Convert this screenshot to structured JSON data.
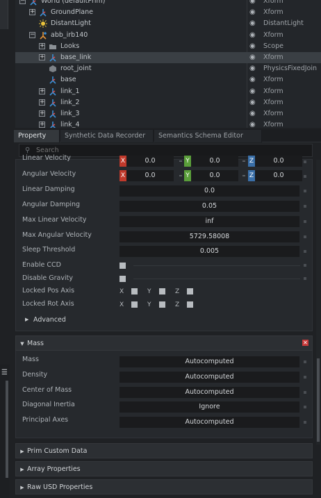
{
  "stage": {
    "rows": [
      {
        "name": "World (defaultPrim)",
        "type": "Xform",
        "icon": "xform-icon",
        "expander": "−",
        "indent": 0
      },
      {
        "name": "GroundPlane",
        "type": "Xform",
        "icon": "xform-icon",
        "expander": "+",
        "indent": 1
      },
      {
        "name": "DistantLight",
        "type": "DistantLight",
        "icon": "light-icon",
        "expander": "",
        "indent": 1
      },
      {
        "name": "abb_irb140",
        "type": "Xform",
        "icon": "robot-icon",
        "expander": "−",
        "indent": 1
      },
      {
        "name": "Looks",
        "type": "Scope",
        "icon": "folder-icon",
        "expander": "+",
        "indent": 2
      },
      {
        "name": "base_link",
        "type": "Xform",
        "icon": "xform-icon",
        "expander": "+",
        "indent": 2,
        "selected": true
      },
      {
        "name": "root_joint",
        "type": "PhysicsFixedJoin",
        "icon": "joint-icon",
        "expander": "",
        "indent": 2
      },
      {
        "name": "base",
        "type": "Xform",
        "icon": "xform-icon",
        "expander": "",
        "indent": 2
      },
      {
        "name": "link_1",
        "type": "Xform",
        "icon": "xform-icon",
        "expander": "+",
        "indent": 2
      },
      {
        "name": "link_2",
        "type": "Xform",
        "icon": "xform-icon",
        "expander": "+",
        "indent": 2
      },
      {
        "name": "link_3",
        "type": "Xform",
        "icon": "xform-icon",
        "expander": "+",
        "indent": 2
      },
      {
        "name": "link_4",
        "type": "Xform",
        "icon": "xform-icon",
        "expander": "+",
        "indent": 2
      }
    ]
  },
  "tabs": [
    "Property",
    "Synthetic Data Recorder",
    "Semantics Schema Editor"
  ],
  "search": {
    "placeholder": "Search"
  },
  "rigid_body": {
    "linear_velocity": {
      "label": "Linear Velocity",
      "x": "0.0",
      "y": "0.0",
      "z": "0.0"
    },
    "angular_velocity": {
      "label": "Angular Velocity",
      "x": "0.0",
      "y": "0.0",
      "z": "0.0"
    },
    "linear_damping": {
      "label": "Linear Damping",
      "value": "0.0"
    },
    "angular_damping": {
      "label": "Angular Damping",
      "value": "0.05"
    },
    "max_linear_velocity": {
      "label": "Max Linear Velocity",
      "value": "inf"
    },
    "max_angular_velocity": {
      "label": "Max Angular Velocity",
      "value": "5729.58008"
    },
    "sleep_threshold": {
      "label": "Sleep Threshold",
      "value": "0.005"
    },
    "enable_ccd": {
      "label": "Enable CCD"
    },
    "disable_gravity": {
      "label": "Disable Gravity"
    },
    "locked_pos_axis": {
      "label": "Locked Pos Axis"
    },
    "locked_rot_axis": {
      "label": "Locked Rot Axis"
    },
    "axis_letters": {
      "x": "X",
      "y": "Y",
      "z": "Z"
    },
    "advanced": "Advanced"
  },
  "mass": {
    "title": "Mass",
    "rows": [
      {
        "label": "Mass",
        "value": "Autocomputed"
      },
      {
        "label": "Density",
        "value": "Autocomputed"
      },
      {
        "label": "Center of Mass",
        "value": "Autocomputed"
      },
      {
        "label": "Diagonal Inertia",
        "value": "Ignore"
      },
      {
        "label": "Principal Axes",
        "value": "Autocomputed"
      }
    ]
  },
  "collapsed_sections": [
    "Prim Custom Data",
    "Array Properties",
    "Raw USD Properties"
  ],
  "colors": {
    "x_axis": "#c0392b",
    "y_axis": "#5a9e3a",
    "z_axis": "#3a6fa8",
    "accent": "#c83a3a"
  }
}
